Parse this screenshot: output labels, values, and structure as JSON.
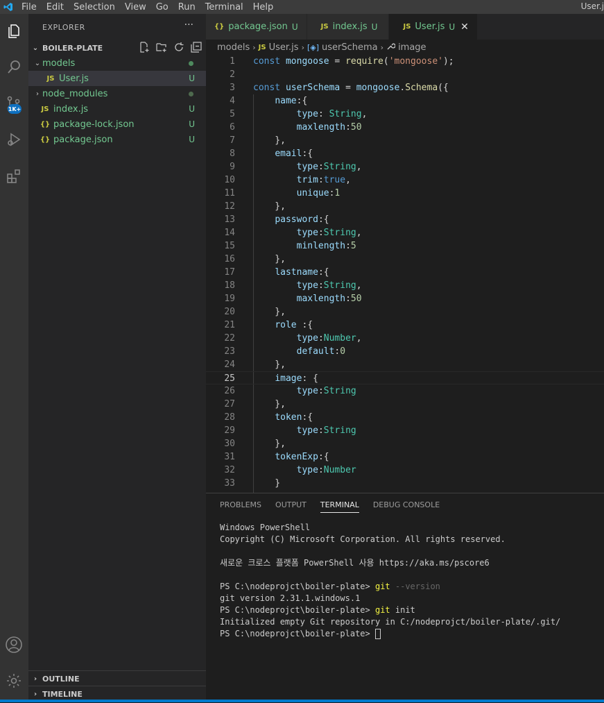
{
  "menubar": {
    "items": [
      "File",
      "Edit",
      "Selection",
      "View",
      "Go",
      "Run",
      "Terminal",
      "Help"
    ],
    "window_title": "User.j"
  },
  "activity_bar": {
    "icons": [
      "explorer-icon",
      "search-icon",
      "source-control-icon",
      "run-debug-icon",
      "extensions-icon",
      "account-icon",
      "settings-icon"
    ],
    "badge": "1K+"
  },
  "sidebar": {
    "title": "EXPLORER",
    "more": "···",
    "project": "BOILER-PLATE",
    "tree": [
      {
        "label": "models",
        "type": "folder",
        "color": "#73c991"
      },
      {
        "label": "User.js",
        "type": "js",
        "status": "U",
        "color": "#73c991"
      },
      {
        "label": "node_modules",
        "type": "folder",
        "color": "#8c8c8c"
      },
      {
        "label": "index.js",
        "type": "js",
        "status": "U",
        "color": "#73c991"
      },
      {
        "label": "package-lock.json",
        "type": "json",
        "status": "U",
        "color": "#73c991"
      },
      {
        "label": "package.json",
        "type": "json",
        "status": "U",
        "color": "#73c991"
      }
    ],
    "outline": "OUTLINE",
    "timeline": "TIMELINE"
  },
  "tabs": [
    {
      "icon": "{}",
      "label": "package.json",
      "status": "U"
    },
    {
      "icon": "JS",
      "label": "index.js",
      "status": "U"
    },
    {
      "icon": "JS",
      "label": "User.js",
      "status": "U",
      "close": "✕"
    }
  ],
  "breadcrumb": {
    "folder": "models",
    "file_icon": "JS",
    "file": "User.js",
    "symbol1": "userSchema",
    "symbol2": "image"
  },
  "editor": {
    "current_line": 25,
    "lines": [
      [
        [
          "kw",
          "const "
        ],
        [
          "vr",
          "mongoose"
        ],
        [
          "pn",
          " = "
        ],
        [
          "fn",
          "require"
        ],
        [
          "pn",
          "("
        ],
        [
          "str",
          "'mongoose'"
        ],
        [
          "pn",
          ");"
        ]
      ],
      [],
      [
        [
          "kw",
          "const "
        ],
        [
          "vr",
          "userSchema"
        ],
        [
          "pn",
          " = "
        ],
        [
          "vr",
          "mongoose"
        ],
        [
          "pn",
          "."
        ],
        [
          "fn",
          "Schema"
        ],
        [
          "pn",
          "({"
        ]
      ],
      [
        [
          "pn",
          "    "
        ],
        [
          "vr",
          "name"
        ],
        [
          "pn",
          ":{"
        ]
      ],
      [
        [
          "pn",
          "        "
        ],
        [
          "vr",
          "type"
        ],
        [
          "pn",
          ": "
        ],
        [
          "cl",
          "String"
        ],
        [
          "pn",
          ","
        ]
      ],
      [
        [
          "pn",
          "        "
        ],
        [
          "vr",
          "maxlength"
        ],
        [
          "pn",
          ":"
        ],
        [
          "num",
          "50"
        ]
      ],
      [
        [
          "pn",
          "    },"
        ]
      ],
      [
        [
          "pn",
          "    "
        ],
        [
          "vr",
          "email"
        ],
        [
          "pn",
          ":{"
        ]
      ],
      [
        [
          "pn",
          "        "
        ],
        [
          "vr",
          "type"
        ],
        [
          "pn",
          ":"
        ],
        [
          "cl",
          "String"
        ],
        [
          "pn",
          ","
        ]
      ],
      [
        [
          "pn",
          "        "
        ],
        [
          "vr",
          "trim"
        ],
        [
          "pn",
          ":"
        ],
        [
          "kw",
          "true"
        ],
        [
          "pn",
          ","
        ]
      ],
      [
        [
          "pn",
          "        "
        ],
        [
          "vr",
          "unique"
        ],
        [
          "pn",
          ":"
        ],
        [
          "num",
          "1"
        ]
      ],
      [
        [
          "pn",
          "    },"
        ]
      ],
      [
        [
          "pn",
          "    "
        ],
        [
          "vr",
          "password"
        ],
        [
          "pn",
          ":{"
        ]
      ],
      [
        [
          "pn",
          "        "
        ],
        [
          "vr",
          "type"
        ],
        [
          "pn",
          ":"
        ],
        [
          "cl",
          "String"
        ],
        [
          "pn",
          ","
        ]
      ],
      [
        [
          "pn",
          "        "
        ],
        [
          "vr",
          "minlength"
        ],
        [
          "pn",
          ":"
        ],
        [
          "num",
          "5"
        ]
      ],
      [
        [
          "pn",
          "    },"
        ]
      ],
      [
        [
          "pn",
          "    "
        ],
        [
          "vr",
          "lastname"
        ],
        [
          "pn",
          ":{"
        ]
      ],
      [
        [
          "pn",
          "        "
        ],
        [
          "vr",
          "type"
        ],
        [
          "pn",
          ":"
        ],
        [
          "cl",
          "String"
        ],
        [
          "pn",
          ","
        ]
      ],
      [
        [
          "pn",
          "        "
        ],
        [
          "vr",
          "maxlength"
        ],
        [
          "pn",
          ":"
        ],
        [
          "num",
          "50"
        ]
      ],
      [
        [
          "pn",
          "    },"
        ]
      ],
      [
        [
          "pn",
          "    "
        ],
        [
          "vr",
          "role"
        ],
        [
          "pn",
          " :{"
        ]
      ],
      [
        [
          "pn",
          "        "
        ],
        [
          "vr",
          "type"
        ],
        [
          "pn",
          ":"
        ],
        [
          "cl",
          "Number"
        ],
        [
          "pn",
          ","
        ]
      ],
      [
        [
          "pn",
          "        "
        ],
        [
          "vr",
          "default"
        ],
        [
          "pn",
          ":"
        ],
        [
          "num",
          "0"
        ]
      ],
      [
        [
          "pn",
          "    },"
        ]
      ],
      [
        [
          "pn",
          "    "
        ],
        [
          "vr",
          "image"
        ],
        [
          "pn",
          ": {"
        ]
      ],
      [
        [
          "pn",
          "        "
        ],
        [
          "vr",
          "type"
        ],
        [
          "pn",
          ":"
        ],
        [
          "cl",
          "String"
        ]
      ],
      [
        [
          "pn",
          "    },"
        ]
      ],
      [
        [
          "pn",
          "    "
        ],
        [
          "vr",
          "token"
        ],
        [
          "pn",
          ":{"
        ]
      ],
      [
        [
          "pn",
          "        "
        ],
        [
          "vr",
          "type"
        ],
        [
          "pn",
          ":"
        ],
        [
          "cl",
          "String"
        ]
      ],
      [
        [
          "pn",
          "    },"
        ]
      ],
      [
        [
          "pn",
          "    "
        ],
        [
          "vr",
          "tokenExp"
        ],
        [
          "pn",
          ":{"
        ]
      ],
      [
        [
          "pn",
          "        "
        ],
        [
          "vr",
          "type"
        ],
        [
          "pn",
          ":"
        ],
        [
          "cl",
          "Number"
        ]
      ],
      [
        [
          "pn",
          "    }"
        ]
      ]
    ]
  },
  "panel": {
    "tabs": [
      "PROBLEMS",
      "OUTPUT",
      "TERMINAL",
      "DEBUG CONSOLE"
    ],
    "active_tab": "TERMINAL",
    "terminal": [
      [
        [
          "t",
          "Windows PowerShell"
        ]
      ],
      [
        [
          "t",
          "Copyright (C) Microsoft Corporation. All rights reserved."
        ]
      ],
      [],
      [
        [
          "t",
          "새로운 크로스 플랫폼 PowerShell 사용 https://aka.ms/pscore6"
        ]
      ],
      [],
      [
        [
          "t",
          "PS C:\\nodeprojct\\boiler-plate> "
        ],
        [
          "c",
          "git "
        ],
        [
          "f",
          "--version"
        ]
      ],
      [
        [
          "t",
          "git version 2.31.1.windows.1"
        ]
      ],
      [
        [
          "t",
          "PS C:\\nodeprojct\\boiler-plate> "
        ],
        [
          "c",
          "git "
        ],
        [
          "t",
          "init"
        ]
      ],
      [
        [
          "t",
          "Initialized empty Git repository in C:/nodeprojct/boiler-plate/.git/"
        ]
      ],
      [
        [
          "t",
          "PS C:\\nodeprojct\\boiler-plate> "
        ],
        [
          "cursor",
          ""
        ]
      ]
    ]
  },
  "colors": {
    "accent": "#007acc",
    "untracked": "#73c991",
    "js_icon": "#cbcb41",
    "json_icon": "#cbcb41"
  }
}
